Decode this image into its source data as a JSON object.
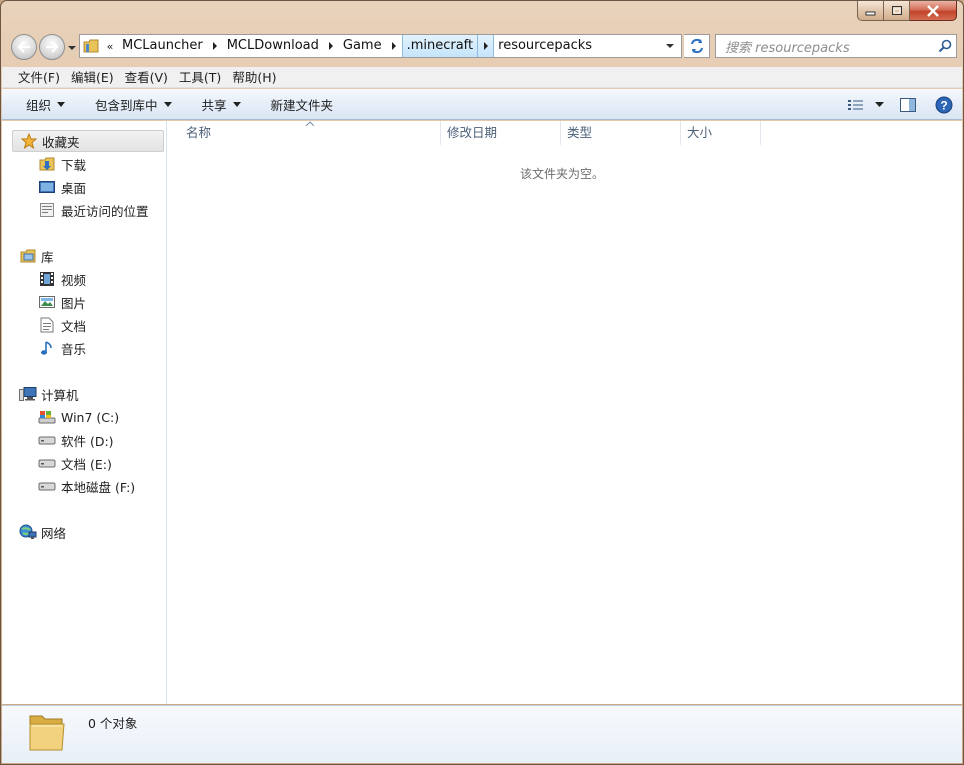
{
  "window": {
    "caption_buttons": {
      "minimize": "minimize-icon",
      "maximize": "maximize-icon",
      "close": "close-icon"
    }
  },
  "address": {
    "overflow": "«",
    "breadcrumbs": [
      "MCLauncher",
      "MCLDownload",
      "Game",
      ".minecraft",
      "resourcepacks"
    ]
  },
  "search": {
    "placeholder": "搜索 resourcepacks"
  },
  "menu": [
    "文件(F)",
    "编辑(E)",
    "查看(V)",
    "工具(T)",
    "帮助(H)"
  ],
  "commands": {
    "organize": "组织",
    "include_in_library": "包含到库中",
    "share": "共享",
    "new_folder": "新建文件夹"
  },
  "navpane": {
    "favorites": {
      "label": "收藏夹",
      "items": [
        "下载",
        "桌面",
        "最近访问的位置"
      ]
    },
    "libraries": {
      "label": "库",
      "items": [
        "视频",
        "图片",
        "文档",
        "音乐"
      ]
    },
    "computer": {
      "label": "计算机",
      "items": [
        "Win7 (C:)",
        "软件 (D:)",
        "文档 (E:)",
        "本地磁盘 (F:)"
      ]
    },
    "network": {
      "label": "网络"
    }
  },
  "columns": {
    "name": "名称",
    "modified": "修改日期",
    "type": "类型",
    "size": "大小"
  },
  "empty_message": "该文件夹为空。",
  "status": {
    "count": "0 个对象"
  },
  "colors": {
    "titlebar": "#d9b995",
    "command_bar": "#e6eef8",
    "selection": "#c4e4fb",
    "close_button": "#c2432a"
  }
}
